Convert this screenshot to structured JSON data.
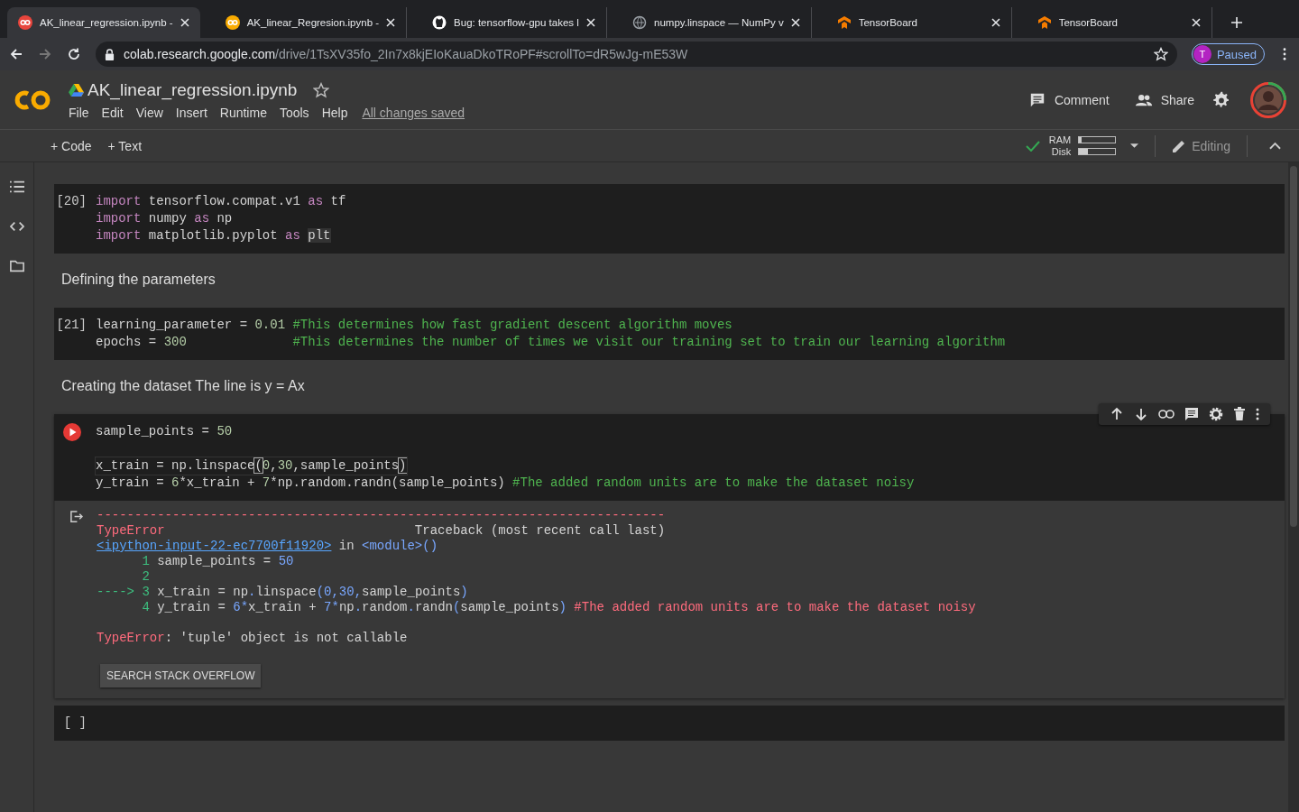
{
  "browser": {
    "tabs": [
      {
        "title": "AK_linear_regression.ipynb -",
        "kind": "colab",
        "selected": true
      },
      {
        "title": "AK_linear_Regresion.ipynb -",
        "kind": "colab",
        "selected": false
      },
      {
        "title": "Bug: tensorflow-gpu takes l",
        "kind": "github",
        "selected": false
      },
      {
        "title": "numpy.linspace — NumPy v",
        "kind": "globe",
        "selected": false
      },
      {
        "title": "TensorBoard",
        "kind": "tensorboard",
        "selected": false
      },
      {
        "title": "TensorBoard",
        "kind": "tensorboard",
        "selected": false
      }
    ],
    "address": {
      "domain": "colab.research.google.com",
      "path": "/drive/1TsXV35fo_2In7x8kjEIoKauaDkoTRoPF#scrollTo=dR5wJg-mE53W"
    },
    "profile": {
      "initial": "T",
      "label": "Paused"
    }
  },
  "notebook": {
    "title": "AK_linear_regression.ipynb",
    "menu": [
      "File",
      "Edit",
      "View",
      "Insert",
      "Runtime",
      "Tools",
      "Help"
    ],
    "save_status": "All changes saved",
    "actions": [
      "Comment",
      "Share"
    ]
  },
  "toolbar": {
    "add": [
      "+ Code",
      "+ Text"
    ],
    "connected": true,
    "ram": {
      "label": "RAM",
      "level": 0.06
    },
    "disk": {
      "label": "Disk",
      "level": 0.25
    },
    "mode": "Editing"
  },
  "cells": [
    {
      "kind": "code",
      "prompt": "[20]",
      "focused": false,
      "lines": [
        {
          "tokens": [
            {
              "t": "import",
              "kind": "kw"
            },
            {
              "t": " tensorflow.compat.v1 ",
              "kind": "plain"
            },
            {
              "t": "as",
              "kind": "kw"
            },
            {
              "t": " tf",
              "kind": "plain"
            }
          ]
        },
        {
          "tokens": [
            {
              "t": "import",
              "kind": "kw"
            },
            {
              "t": " numpy ",
              "kind": "plain"
            },
            {
              "t": "as",
              "kind": "kw"
            },
            {
              "t": " np",
              "kind": "plain"
            }
          ]
        },
        {
          "tokens": [
            {
              "t": "import",
              "kind": "kw"
            },
            {
              "t": " matplotlib.pyplot ",
              "kind": "plain"
            },
            {
              "t": "as ",
              "kind": "kw"
            },
            {
              "t": "plt",
              "kind": "hl"
            }
          ]
        }
      ]
    },
    {
      "kind": "text",
      "text": "Defining the parameters"
    },
    {
      "kind": "code",
      "prompt": "[21]",
      "focused": false,
      "lines": [
        {
          "tokens": [
            {
              "t": "learning_parameter = ",
              "kind": "plain"
            },
            {
              "t": "0.01",
              "kind": "num"
            },
            {
              "t": " #This determines how fast gradient descent algorithm moves",
              "kind": "comment"
            }
          ]
        },
        {
          "tokens": [
            {
              "t": "epochs = ",
              "kind": "plain"
            },
            {
              "t": "300",
              "kind": "num"
            },
            {
              "t": "              #This determines the number of times we visit our training set to train our learning algorithm",
              "kind": "comment"
            }
          ]
        }
      ]
    },
    {
      "kind": "text",
      "text": "Creating the dataset The line is y = Ax"
    },
    {
      "kind": "code",
      "error": true,
      "focused": true,
      "lines": [
        {
          "tokens": [
            {
              "t": "sample_points = ",
              "kind": "plain"
            },
            {
              "t": "50",
              "kind": "num"
            }
          ]
        },
        {
          "kind": "blank"
        },
        {
          "tokens": [
            {
              "t": "x_train = np.linspace",
              "kind": "plain"
            },
            {
              "t": "(",
              "kind": "bracket"
            },
            {
              "t": "0",
              "kind": "num"
            },
            {
              "t": ",",
              "kind": "plain"
            },
            {
              "t": "30",
              "kind": "num"
            },
            {
              "t": ",sample_points",
              "kind": "plain"
            },
            {
              "t": ")",
              "kind": "bracket"
            }
          ]
        },
        {
          "tokens": [
            {
              "t": "y_train = ",
              "kind": "plain"
            },
            {
              "t": "6",
              "kind": "num"
            },
            {
              "t": "*x_train + ",
              "kind": "plain"
            },
            {
              "t": "7",
              "kind": "num"
            },
            {
              "t": "*np.random.randn(sample_points) ",
              "kind": "plain"
            },
            {
              "t": "#The added random units are to make the dataset noisy",
              "kind": "comment"
            }
          ]
        }
      ],
      "output": {
        "lines": [
          {
            "tokens": [
              {
                "t": "---------------------------------------------------------------------------",
                "kind": "err"
              }
            ]
          },
          {
            "tokens": [
              {
                "t": "TypeError",
                "kind": "err"
              },
              {
                "t": "                                 Traceback (most recent call last)",
                "kind": "plain"
              }
            ]
          },
          {
            "tokens": [
              {
                "t": "<ipython-input-22-ec7700f11920>",
                "kind": "link"
              },
              {
                "t": " in ",
                "kind": "plain"
              },
              {
                "t": "<module>()",
                "kind": "op"
              }
            ]
          },
          {
            "tokens": [
              {
                "t": "      1",
                "kind": "lno"
              },
              {
                "t": " sample_points = ",
                "kind": "plain"
              },
              {
                "t": "50",
                "kind": "op"
              }
            ]
          },
          {
            "tokens": [
              {
                "t": "      2",
                "kind": "lno"
              }
            ]
          },
          {
            "tokens": [
              {
                "t": "----> 3",
                "kind": "lno"
              },
              {
                "t": " x_train = np",
                "kind": "plain"
              },
              {
                "t": ".",
                "kind": "op"
              },
              {
                "t": "linspace",
                "kind": "plain"
              },
              {
                "t": "(0,30,",
                "kind": "op"
              },
              {
                "t": "sample_points",
                "kind": "plain"
              },
              {
                "t": ")",
                "kind": "op"
              }
            ]
          },
          {
            "tokens": [
              {
                "t": "      4",
                "kind": "lno"
              },
              {
                "t": " y_train = ",
                "kind": "plain"
              },
              {
                "t": "6*",
                "kind": "op"
              },
              {
                "t": "x_train + ",
                "kind": "plain"
              },
              {
                "t": "7*",
                "kind": "op"
              },
              {
                "t": "np",
                "kind": "plain"
              },
              {
                "t": ".",
                "kind": "op"
              },
              {
                "t": "random",
                "kind": "plain"
              },
              {
                "t": ".",
                "kind": "op"
              },
              {
                "t": "randn",
                "kind": "plain"
              },
              {
                "t": "(",
                "kind": "op"
              },
              {
                "t": "sample_points",
                "kind": "plain"
              },
              {
                "t": ")",
                "kind": "op"
              },
              {
                "t": " #The added random units are to make the dataset noisy",
                "kind": "err"
              }
            ]
          },
          {
            "kind": "blank"
          },
          {
            "tokens": [
              {
                "t": "TypeError",
                "kind": "err"
              },
              {
                "t": ": 'tuple' object is not callable",
                "kind": "plain"
              }
            ]
          }
        ],
        "button": "SEARCH STACK OVERFLOW"
      }
    },
    {
      "kind": "code",
      "prompt": "[ ]",
      "focused": false
    }
  ]
}
